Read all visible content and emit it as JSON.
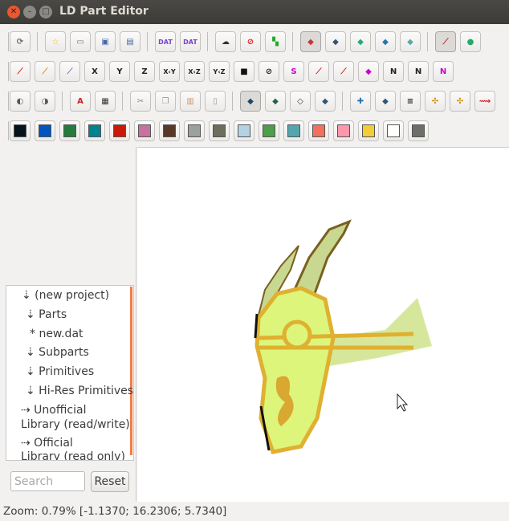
{
  "window": {
    "title": "LD Part Editor",
    "close_icon": "close-icon",
    "minimize_icon": "minimize-icon",
    "maximize_icon": "maximize-icon"
  },
  "toolbars": [
    [
      {
        "sep": 1
      },
      {
        "icon": "refresh-icon",
        "g": "⟳",
        "c": "#666"
      },
      {
        "sep": 1
      },
      {
        "icon": "new-file-icon",
        "g": "☆",
        "c": "#e0c020"
      },
      {
        "icon": "open-folder-icon",
        "g": "▭",
        "c": "#777"
      },
      {
        "icon": "save-icon",
        "g": "▣",
        "c": "#4466aa"
      },
      {
        "icon": "save-all-icon",
        "g": "▤",
        "c": "#4466aa"
      },
      {
        "sep": 1
      },
      {
        "icon": "new-dat-icon",
        "g": "DAT",
        "c": "#7a3fd0"
      },
      {
        "icon": "open-dat-icon",
        "g": "DAT",
        "c": "#7a3fd0"
      },
      {
        "sep": 1
      },
      {
        "icon": "ghost-icon",
        "g": "☁",
        "c": "#333"
      },
      {
        "icon": "no-ghost-icon",
        "g": "⊘",
        "c": "#d22"
      },
      {
        "icon": "sync-icon",
        "g": "▚",
        "c": "#2a2"
      },
      {
        "sep": 1
      },
      {
        "icon": "view-mode-1-icon",
        "g": "◆",
        "c": "#c33",
        "p": 1
      },
      {
        "icon": "view-mode-2-icon",
        "g": "◆",
        "c": "#357"
      },
      {
        "icon": "view-mode-3-icon",
        "g": "◆",
        "c": "#2a7"
      },
      {
        "icon": "view-mode-4-icon",
        "g": "◆",
        "c": "#27a"
      },
      {
        "icon": "view-mode-5-icon",
        "g": "◆",
        "c": "#5aa"
      },
      {
        "sep": 1
      },
      {
        "icon": "axes-icon",
        "g": "⟋",
        "c": "#c22",
        "p": 1
      },
      {
        "icon": "globe-icon",
        "g": "●",
        "c": "#2a6"
      }
    ],
    [
      {
        "sep": 1
      },
      {
        "icon": "grid-coarse-icon",
        "g": "⟋",
        "c": "#c22"
      },
      {
        "icon": "grid-medium-icon",
        "g": "⟋",
        "c": "#e80"
      },
      {
        "icon": "grid-fine-icon",
        "g": "⟋",
        "c": "#96c"
      },
      {
        "icon": "mirror-x-icon",
        "g": "X",
        "c": "#222"
      },
      {
        "icon": "mirror-y-icon",
        "g": "Y",
        "c": "#222"
      },
      {
        "icon": "mirror-z-icon",
        "g": "Z",
        "c": "#222"
      },
      {
        "icon": "swap-xy-icon",
        "g": "X‹Y",
        "c": "#222"
      },
      {
        "icon": "swap-xz-icon",
        "g": "X‹Z",
        "c": "#222"
      },
      {
        "icon": "swap-yz-icon",
        "g": "Y‹Z",
        "c": "#222"
      },
      {
        "icon": "camera-icon",
        "g": "■",
        "c": "#111"
      },
      {
        "icon": "no-transform-icon",
        "g": "⊘",
        "c": "#222"
      },
      {
        "icon": "snap-1-icon",
        "g": "S",
        "c": "#c0c"
      },
      {
        "icon": "snap-2-icon",
        "g": "⟋",
        "c": "#c22"
      },
      {
        "icon": "snap-3-icon",
        "g": "⟋",
        "c": "#c22"
      },
      {
        "icon": "snap-4-icon",
        "g": "◆",
        "c": "#c0c"
      },
      {
        "icon": "normal-1-icon",
        "g": "N",
        "c": "#222"
      },
      {
        "icon": "normal-2-icon",
        "g": "N",
        "c": "#222"
      },
      {
        "icon": "normal-3-icon",
        "g": "N",
        "c": "#c0c"
      }
    ],
    [
      {
        "sep": 1
      },
      {
        "icon": "zoom-in-icon",
        "g": "◐",
        "c": "#555"
      },
      {
        "icon": "zoom-out-icon",
        "g": "◑",
        "c": "#555"
      },
      {
        "sep": 1
      },
      {
        "icon": "triangle-tool-icon",
        "g": "A",
        "c": "#c22"
      },
      {
        "icon": "screenshot-icon",
        "g": "▦",
        "c": "#333"
      },
      {
        "sep": 1
      },
      {
        "icon": "cut-icon",
        "g": "✂",
        "c": "#888"
      },
      {
        "icon": "copy-icon",
        "g": "❐",
        "c": "#999"
      },
      {
        "icon": "paste-icon",
        "g": "▥",
        "c": "#c96"
      },
      {
        "icon": "delete-icon",
        "g": "▯",
        "c": "#999"
      },
      {
        "sep": 1
      },
      {
        "icon": "select-vertex-icon",
        "g": "◆",
        "c": "#246",
        "p": 1
      },
      {
        "icon": "select-line-icon",
        "g": "◆",
        "c": "#264"
      },
      {
        "icon": "select-triangle-icon",
        "g": "◇",
        "c": "#333"
      },
      {
        "icon": "select-quad-icon",
        "g": "◆",
        "c": "#357"
      },
      {
        "sep": 1
      },
      {
        "icon": "add-vertex-icon",
        "g": "✚",
        "c": "#27a"
      },
      {
        "icon": "add-line-icon",
        "g": "◆",
        "c": "#357"
      },
      {
        "icon": "add-cond-line-icon",
        "g": "≡",
        "c": "#223"
      },
      {
        "icon": "add-triangle-icon",
        "g": "✣",
        "c": "#c80"
      },
      {
        "icon": "add-quad-icon",
        "g": "✣",
        "c": "#c80"
      },
      {
        "icon": "add-subfile-icon",
        "g": "⟿",
        "c": "#c22"
      }
    ],
    [
      {
        "sep": 1
      },
      {
        "color": "#05131d"
      },
      {
        "color": "#0055bf"
      },
      {
        "color": "#257a3e"
      },
      {
        "color": "#00838f"
      },
      {
        "color": "#c91a09"
      },
      {
        "color": "#c870a0"
      },
      {
        "color": "#583927"
      },
      {
        "color": "#9ba19d"
      },
      {
        "color": "#6d6e5c"
      },
      {
        "color": "#b4d2e3"
      },
      {
        "color": "#4b9f4a"
      },
      {
        "color": "#55a5af"
      },
      {
        "color": "#f2705e"
      },
      {
        "color": "#fc97ac"
      },
      {
        "color": "#f2cd37"
      },
      {
        "color": "#ffffff"
      },
      {
        "color": "#6c6e68"
      }
    ]
  ],
  "tree": {
    "items": [
      {
        "label": "⇣ (new project)"
      },
      {
        "label": "⇣ Parts"
      },
      {
        "label": "* new.dat"
      },
      {
        "label": "⇣ Subparts"
      },
      {
        "label": "⇣ Primitives"
      },
      {
        "label": "⇣ Hi-Res Primitives"
      },
      {
        "label": "⇢ Unofficial"
      },
      {
        "label": "Library (read/write)"
      },
      {
        "label": "⇢ Official"
      },
      {
        "label": "Library (read only)"
      }
    ]
  },
  "search": {
    "placeholder": "Search",
    "value": ""
  },
  "reset_label": "Reset",
  "status": "Zoom: 0.79% [-1.1370;  16.2306;  5.7340]",
  "model_colors": {
    "fill": "#dcf57a",
    "trim": "#e0b030",
    "edge": "#222"
  }
}
